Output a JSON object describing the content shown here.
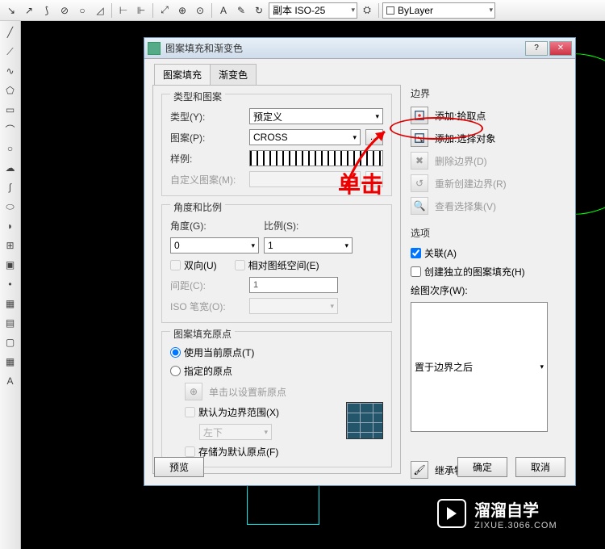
{
  "toolbar_top": {
    "dimstyle": "副本 ISO-25",
    "layer": "ByLayer"
  },
  "dialog": {
    "title": "图案填充和渐变色",
    "tabs": [
      "图案填充",
      "渐变色"
    ],
    "type_section": {
      "title": "类型和图案",
      "type_label": "类型(Y):",
      "type_value": "预定义",
      "pattern_label": "图案(P):",
      "pattern_value": "CROSS",
      "sample_label": "样例:",
      "custom_label": "自定义图案(M):"
    },
    "angle_section": {
      "title": "角度和比例",
      "angle_label": "角度(G):",
      "scale_label": "比例(S):",
      "angle_value": "0",
      "scale_value": "1",
      "double_label": "双向(U)",
      "relative_label": "相对图纸空间(E)",
      "spacing_label": "间距(C):",
      "spacing_value": "1",
      "iso_label": "ISO 笔宽(O):"
    },
    "origin_section": {
      "title": "图案填充原点",
      "use_current": "使用当前原点(T)",
      "specified": "指定的原点",
      "click_set": "单击以设置新原点",
      "default_ext": "默认为边界范围(X)",
      "corner_value": "左下",
      "store_default": "存储为默认原点(F)"
    },
    "boundary": {
      "title": "边界",
      "pick": "添加:拾取点",
      "select": "添加:选择对象",
      "remove": "删除边界(D)",
      "recreate": "重新创建边界(R)",
      "view": "查看选择集(V)"
    },
    "options": {
      "title": "选项",
      "assoc": "关联(A)",
      "indep": "创建独立的图案填充(H)",
      "draw_order_label": "绘图次序(W):",
      "draw_order_value": "置于边界之后"
    },
    "inherit": "继承特性",
    "buttons": {
      "preview": "预览",
      "ok": "确定",
      "cancel": "取消"
    }
  },
  "annotation": "单击",
  "watermark": {
    "title": "溜溜自学",
    "sub": "ZIXUE.3066.COM"
  }
}
